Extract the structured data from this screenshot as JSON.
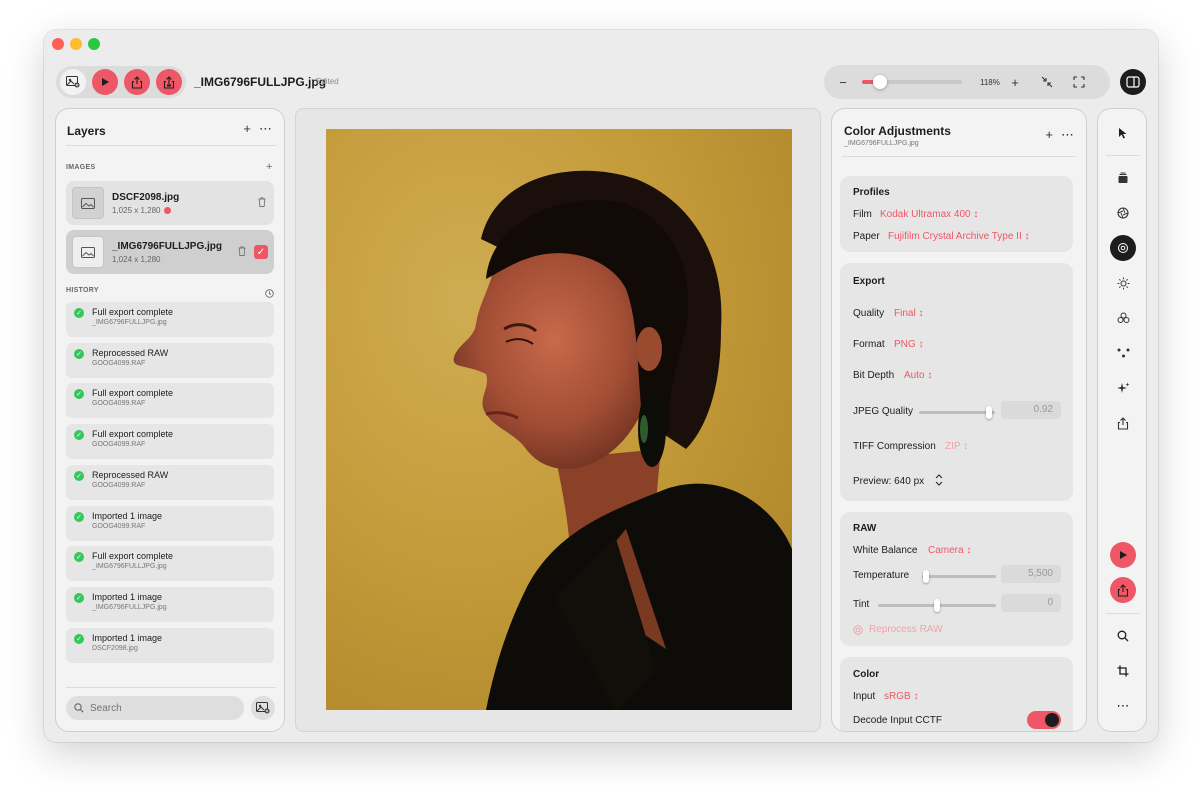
{
  "toolbar": {
    "file_name": "_IMG6796FULLJPG.jpg",
    "status": "Edited",
    "icons": [
      "image-add-icon",
      "play-icon",
      "share-icon",
      "export-icon"
    ]
  },
  "zoom": {
    "value_label": "118%",
    "level": 0.18,
    "icons": [
      "minus-icon",
      "plus-icon",
      "collapse-icon",
      "fullscreen-icon",
      "sidebar-toggle-icon"
    ]
  },
  "layers": {
    "title": "Layers",
    "images_label": "IMAGES",
    "images": [
      {
        "name": "DSCF2098.jpg",
        "size": "1,025 x 1,280",
        "warning": true,
        "selected": false
      },
      {
        "name": "_IMG6796FULLJPG.jpg",
        "size": "1,024 x 1,280",
        "warning": false,
        "selected": true
      }
    ],
    "history_label": "HISTORY",
    "history": [
      {
        "title": "Full export complete",
        "file": "_IMG6796FULLJPG.jpg"
      },
      {
        "title": "Reprocessed RAW",
        "file": "GOOG4099.RAF"
      },
      {
        "title": "Full export complete",
        "file": "GOOG4099.RAF"
      },
      {
        "title": "Full export complete",
        "file": "GOOG4099.RAF"
      },
      {
        "title": "Reprocessed RAW",
        "file": "GOOG4099.RAF"
      },
      {
        "title": "Imported 1 image",
        "file": "GOOG4099.RAF"
      },
      {
        "title": "Full export complete",
        "file": "_IMG6796FULLJPG.jpg"
      },
      {
        "title": "Imported 1 image",
        "file": "_IMG6796FULLJPG.jpg"
      },
      {
        "title": "Imported 1 image",
        "file": "DSCF2098.jpg"
      }
    ],
    "search_placeholder": "Search"
  },
  "adjust": {
    "title": "Color Adjustments",
    "subtitle": "_IMG6796FULLJPG.jpg",
    "profiles": {
      "title": "Profiles",
      "film_label": "Film",
      "film_value": "Kodak Ultramax 400 ↕",
      "paper_label": "Paper",
      "paper_value": "Fujifilm Crystal Archive Type II ↕"
    },
    "export": {
      "title": "Export",
      "quality_label": "Quality",
      "quality_value": "Final ↕",
      "format_label": "Format",
      "format_value": "PNG ↕",
      "bitdepth_label": "Bit Depth",
      "bitdepth_value": "Auto ↕",
      "jpeg_label": "JPEG Quality",
      "jpeg_value": "0.92",
      "jpeg_level": 0.92,
      "tiff_label": "TIFF Compression",
      "tiff_value": "ZIP ↕",
      "preview_label": "Preview: 640 px"
    },
    "raw": {
      "title": "RAW",
      "wb_label": "White Balance",
      "wb_value": "Camera ↕",
      "temp_label": "Temperature",
      "temp_value": "5,500",
      "temp_level": 0.05,
      "tint_label": "Tint",
      "tint_value": "0",
      "tint_level": 0.5,
      "reprocess_label": "Reprocess RAW"
    },
    "color": {
      "title": "Color",
      "input_label": "Input",
      "input_value": "sRGB ↕",
      "decode_label": "Decode Input CCTF",
      "decode_on": true
    }
  },
  "colors": {
    "accent": "#ee5766",
    "success": "#34c759",
    "dark": "#1d1d1f"
  },
  "rail_icons": [
    "pointer-icon",
    "stack-icon",
    "aperture-icon",
    "film-icon",
    "sun-icon",
    "circles-icon",
    "nodes-icon",
    "sparkle-icon",
    "share-icon",
    "play-icon",
    "export-icon",
    "search-icon",
    "crop-icon",
    "more-icon"
  ]
}
